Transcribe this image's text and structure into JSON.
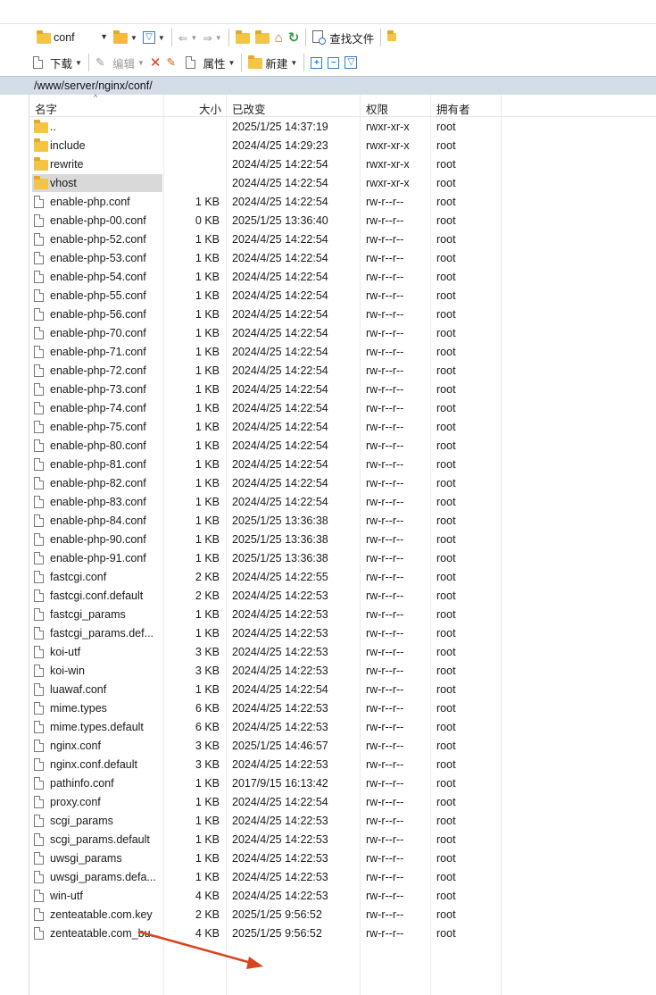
{
  "toolbar1": {
    "location_value": "conf",
    "find_files_label": "查找文件"
  },
  "toolbar2": {
    "download_label": "下载",
    "edit_label": "编辑",
    "properties_label": "属性",
    "new_label": "新建"
  },
  "path": "/www/server/nginx/conf/",
  "columns": {
    "name": "名字",
    "size": "大小",
    "modified": "已改变",
    "permissions": "权限",
    "owner": "拥有者"
  },
  "files": [
    {
      "name": "..",
      "size": "",
      "modified": "2025/1/25 14:37:19",
      "permissions": "rwxr-xr-x",
      "owner": "root",
      "icon": "parent-folder-icon"
    },
    {
      "name": "include",
      "size": "",
      "modified": "2024/4/25 14:29:23",
      "permissions": "rwxr-xr-x",
      "owner": "root",
      "icon": "folder-icon"
    },
    {
      "name": "rewrite",
      "size": "",
      "modified": "2024/4/25 14:22:54",
      "permissions": "rwxr-xr-x",
      "owner": "root",
      "icon": "folder-icon"
    },
    {
      "name": "vhost",
      "size": "",
      "modified": "2024/4/25 14:22:54",
      "permissions": "rwxr-xr-x",
      "owner": "root",
      "icon": "folder-icon",
      "selected": true
    },
    {
      "name": "enable-php.conf",
      "size": "1 KB",
      "modified": "2024/4/25 14:22:54",
      "permissions": "rw-r--r--",
      "owner": "root",
      "icon": "file-icon"
    },
    {
      "name": "enable-php-00.conf",
      "size": "0 KB",
      "modified": "2025/1/25 13:36:40",
      "permissions": "rw-r--r--",
      "owner": "root",
      "icon": "file-icon"
    },
    {
      "name": "enable-php-52.conf",
      "size": "1 KB",
      "modified": "2024/4/25 14:22:54",
      "permissions": "rw-r--r--",
      "owner": "root",
      "icon": "file-icon"
    },
    {
      "name": "enable-php-53.conf",
      "size": "1 KB",
      "modified": "2024/4/25 14:22:54",
      "permissions": "rw-r--r--",
      "owner": "root",
      "icon": "file-icon"
    },
    {
      "name": "enable-php-54.conf",
      "size": "1 KB",
      "modified": "2024/4/25 14:22:54",
      "permissions": "rw-r--r--",
      "owner": "root",
      "icon": "file-icon"
    },
    {
      "name": "enable-php-55.conf",
      "size": "1 KB",
      "modified": "2024/4/25 14:22:54",
      "permissions": "rw-r--r--",
      "owner": "root",
      "icon": "file-icon"
    },
    {
      "name": "enable-php-56.conf",
      "size": "1 KB",
      "modified": "2024/4/25 14:22:54",
      "permissions": "rw-r--r--",
      "owner": "root",
      "icon": "file-icon"
    },
    {
      "name": "enable-php-70.conf",
      "size": "1 KB",
      "modified": "2024/4/25 14:22:54",
      "permissions": "rw-r--r--",
      "owner": "root",
      "icon": "file-icon"
    },
    {
      "name": "enable-php-71.conf",
      "size": "1 KB",
      "modified": "2024/4/25 14:22:54",
      "permissions": "rw-r--r--",
      "owner": "root",
      "icon": "file-icon"
    },
    {
      "name": "enable-php-72.conf",
      "size": "1 KB",
      "modified": "2024/4/25 14:22:54",
      "permissions": "rw-r--r--",
      "owner": "root",
      "icon": "file-icon"
    },
    {
      "name": "enable-php-73.conf",
      "size": "1 KB",
      "modified": "2024/4/25 14:22:54",
      "permissions": "rw-r--r--",
      "owner": "root",
      "icon": "file-icon"
    },
    {
      "name": "enable-php-74.conf",
      "size": "1 KB",
      "modified": "2024/4/25 14:22:54",
      "permissions": "rw-r--r--",
      "owner": "root",
      "icon": "file-icon"
    },
    {
      "name": "enable-php-75.conf",
      "size": "1 KB",
      "modified": "2024/4/25 14:22:54",
      "permissions": "rw-r--r--",
      "owner": "root",
      "icon": "file-icon"
    },
    {
      "name": "enable-php-80.conf",
      "size": "1 KB",
      "modified": "2024/4/25 14:22:54",
      "permissions": "rw-r--r--",
      "owner": "root",
      "icon": "file-icon"
    },
    {
      "name": "enable-php-81.conf",
      "size": "1 KB",
      "modified": "2024/4/25 14:22:54",
      "permissions": "rw-r--r--",
      "owner": "root",
      "icon": "file-icon"
    },
    {
      "name": "enable-php-82.conf",
      "size": "1 KB",
      "modified": "2024/4/25 14:22:54",
      "permissions": "rw-r--r--",
      "owner": "root",
      "icon": "file-icon"
    },
    {
      "name": "enable-php-83.conf",
      "size": "1 KB",
      "modified": "2024/4/25 14:22:54",
      "permissions": "rw-r--r--",
      "owner": "root",
      "icon": "file-icon"
    },
    {
      "name": "enable-php-84.conf",
      "size": "1 KB",
      "modified": "2025/1/25 13:36:38",
      "permissions": "rw-r--r--",
      "owner": "root",
      "icon": "file-icon"
    },
    {
      "name": "enable-php-90.conf",
      "size": "1 KB",
      "modified": "2025/1/25 13:36:38",
      "permissions": "rw-r--r--",
      "owner": "root",
      "icon": "file-icon"
    },
    {
      "name": "enable-php-91.conf",
      "size": "1 KB",
      "modified": "2025/1/25 13:36:38",
      "permissions": "rw-r--r--",
      "owner": "root",
      "icon": "file-icon"
    },
    {
      "name": "fastcgi.conf",
      "size": "2 KB",
      "modified": "2024/4/25 14:22:55",
      "permissions": "rw-r--r--",
      "owner": "root",
      "icon": "file-icon"
    },
    {
      "name": "fastcgi.conf.default",
      "size": "2 KB",
      "modified": "2024/4/25 14:22:53",
      "permissions": "rw-r--r--",
      "owner": "root",
      "icon": "file-icon"
    },
    {
      "name": "fastcgi_params",
      "size": "1 KB",
      "modified": "2024/4/25 14:22:53",
      "permissions": "rw-r--r--",
      "owner": "root",
      "icon": "file-icon"
    },
    {
      "name": "fastcgi_params.def...",
      "size": "1 KB",
      "modified": "2024/4/25 14:22:53",
      "permissions": "rw-r--r--",
      "owner": "root",
      "icon": "file-icon"
    },
    {
      "name": "koi-utf",
      "size": "3 KB",
      "modified": "2024/4/25 14:22:53",
      "permissions": "rw-r--r--",
      "owner": "root",
      "icon": "file-icon"
    },
    {
      "name": "koi-win",
      "size": "3 KB",
      "modified": "2024/4/25 14:22:53",
      "permissions": "rw-r--r--",
      "owner": "root",
      "icon": "file-icon"
    },
    {
      "name": "luawaf.conf",
      "size": "1 KB",
      "modified": "2024/4/25 14:22:54",
      "permissions": "rw-r--r--",
      "owner": "root",
      "icon": "file-icon"
    },
    {
      "name": "mime.types",
      "size": "6 KB",
      "modified": "2024/4/25 14:22:53",
      "permissions": "rw-r--r--",
      "owner": "root",
      "icon": "file-icon"
    },
    {
      "name": "mime.types.default",
      "size": "6 KB",
      "modified": "2024/4/25 14:22:53",
      "permissions": "rw-r--r--",
      "owner": "root",
      "icon": "file-icon"
    },
    {
      "name": "nginx.conf",
      "size": "3 KB",
      "modified": "2025/1/25 14:46:57",
      "permissions": "rw-r--r--",
      "owner": "root",
      "icon": "file-icon"
    },
    {
      "name": "nginx.conf.default",
      "size": "3 KB",
      "modified": "2024/4/25 14:22:53",
      "permissions": "rw-r--r--",
      "owner": "root",
      "icon": "file-icon"
    },
    {
      "name": "pathinfo.conf",
      "size": "1 KB",
      "modified": "2017/9/15 16:13:42",
      "permissions": "rw-r--r--",
      "owner": "root",
      "icon": "file-icon"
    },
    {
      "name": "proxy.conf",
      "size": "1 KB",
      "modified": "2024/4/25 14:22:54",
      "permissions": "rw-r--r--",
      "owner": "root",
      "icon": "file-icon"
    },
    {
      "name": "scgi_params",
      "size": "1 KB",
      "modified": "2024/4/25 14:22:53",
      "permissions": "rw-r--r--",
      "owner": "root",
      "icon": "file-icon"
    },
    {
      "name": "scgi_params.default",
      "size": "1 KB",
      "modified": "2024/4/25 14:22:53",
      "permissions": "rw-r--r--",
      "owner": "root",
      "icon": "file-icon"
    },
    {
      "name": "uwsgi_params",
      "size": "1 KB",
      "modified": "2024/4/25 14:22:53",
      "permissions": "rw-r--r--",
      "owner": "root",
      "icon": "file-icon"
    },
    {
      "name": "uwsgi_params.defa...",
      "size": "1 KB",
      "modified": "2024/4/25 14:22:53",
      "permissions": "rw-r--r--",
      "owner": "root",
      "icon": "file-icon"
    },
    {
      "name": "win-utf",
      "size": "4 KB",
      "modified": "2024/4/25 14:22:53",
      "permissions": "rw-r--r--",
      "owner": "root",
      "icon": "file-icon"
    },
    {
      "name": "zenteatable.com.key",
      "size": "2 KB",
      "modified": "2025/1/25 9:56:52",
      "permissions": "rw-r--r--",
      "owner": "root",
      "icon": "file-icon"
    },
    {
      "name": "zenteatable.com_bu...",
      "size": "4 KB",
      "modified": "2025/1/25 9:56:52",
      "permissions": "rw-r--r--",
      "owner": "root",
      "icon": "certificate-file-icon"
    }
  ],
  "colors": {
    "path_bar": "#d3dde8",
    "selection": "#d9d9d9",
    "folder": "#f4c444",
    "annotation_arrow": "#d9441f"
  }
}
